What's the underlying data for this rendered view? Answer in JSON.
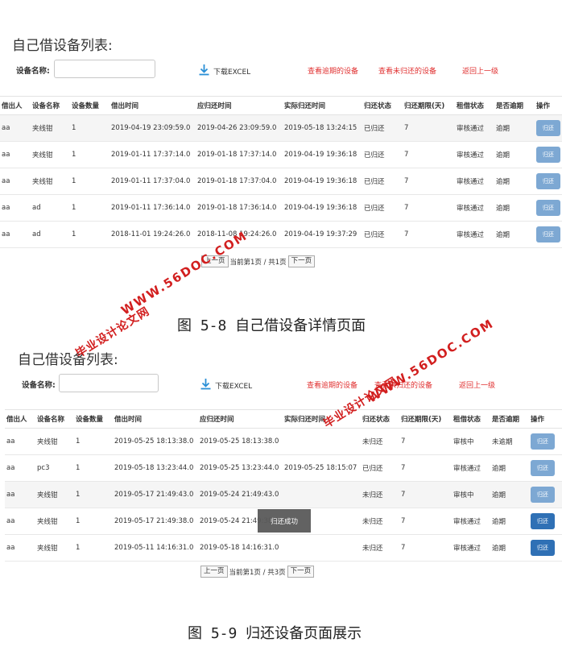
{
  "fig1": {
    "title": "自己借设备列表:",
    "search_label": "设备名称:",
    "search_value": "",
    "download_label": "下载EXCEL",
    "overdue_link": "查看逾期的设备",
    "unreturned_link": "查看未归还的设备",
    "back_link": "返回上一级",
    "columns": [
      "借出人",
      "设备名称",
      "设备数量",
      "借出时间",
      "应归还时间",
      "实际归还时间",
      "归还状态",
      "归还期限(天)",
      "租借状态",
      "是否逾期",
      "操作"
    ],
    "rows": [
      [
        "aa",
        "夹线钳",
        "1",
        "2019-04-19 23:09:59.0",
        "2019-04-26 23:09:59.0",
        "2019-05-18 13:24:15",
        "已归还",
        "7",
        "审核通过",
        "逾期",
        "归还"
      ],
      [
        "aa",
        "夹线钳",
        "1",
        "2019-01-11 17:37:14.0",
        "2019-01-18 17:37:14.0",
        "2019-04-19 19:36:18",
        "已归还",
        "7",
        "审核通过",
        "逾期",
        "归还"
      ],
      [
        "aa",
        "夹线钳",
        "1",
        "2019-01-11 17:37:04.0",
        "2019-01-18 17:37:04.0",
        "2019-04-19 19:36:18",
        "已归还",
        "7",
        "审核通过",
        "逾期",
        "归还"
      ],
      [
        "aa",
        "ad",
        "1",
        "2019-01-11 17:36:14.0",
        "2019-01-18 17:36:14.0",
        "2019-04-19 19:36:18",
        "已归还",
        "7",
        "审核通过",
        "逾期",
        "归还"
      ],
      [
        "aa",
        "ad",
        "1",
        "2018-11-01 19:24:26.0",
        "2018-11-08 19:24:26.0",
        "2019-04-19 19:37:29",
        "已归还",
        "7",
        "审核通过",
        "逾期",
        "归还"
      ]
    ],
    "pager": {
      "prev": "上一页",
      "info": "当前第1页 / 共1页",
      "next": "下一页"
    },
    "caption": "图 5-8 自己借设备详情页面"
  },
  "fig2": {
    "title": "自己借设备列表:",
    "search_label": "设备名称:",
    "search_value": "",
    "download_label": "下载EXCEL",
    "overdue_link": "查看逾期的设备",
    "unreturned_link": "查看未归还的设备",
    "back_link": "返回上一级",
    "columns": [
      "借出人",
      "设备名称",
      "设备数量",
      "借出时间",
      "应归还时间",
      "实际归还时间",
      "归还状态",
      "归还期限(天)",
      "租借状态",
      "是否逾期",
      "操作"
    ],
    "rows": [
      [
        "aa",
        "夹线钳",
        "1",
        "2019-05-25 18:13:38.0",
        "2019-05-25 18:13:38.0",
        "",
        "未归还",
        "7",
        "审核中",
        "未逾期",
        "归还"
      ],
      [
        "aa",
        "pc3",
        "1",
        "2019-05-18 13:23:44.0",
        "2019-05-25 13:23:44.0",
        "2019-05-25 18:15:07",
        "已归还",
        "7",
        "审核通过",
        "逾期",
        "归还"
      ],
      [
        "aa",
        "夹线钳",
        "1",
        "2019-05-17 21:49:43.0",
        "2019-05-24 21:49:43.0",
        "",
        "未归还",
        "7",
        "审核中",
        "逾期",
        "归还"
      ],
      [
        "aa",
        "夹线钳",
        "1",
        "2019-05-17 21:49:38.0",
        "2019-05-24 21:49:38.0",
        "",
        "未归还",
        "7",
        "审核通过",
        "逾期",
        "归还"
      ],
      [
        "aa",
        "夹线钳",
        "1",
        "2019-05-11 14:16:31.0",
        "2019-05-18 14:16:31.0",
        "",
        "未归还",
        "7",
        "审核通过",
        "逾期",
        "归还"
      ]
    ],
    "toast": "归还成功",
    "pager": {
      "prev": "上一页",
      "info": "当前第1页 / 共3页",
      "next": "下一页"
    },
    "caption": "图 5-9 归还设备页面展示"
  },
  "watermarks": {
    "url": "WWW.56DOC.COM",
    "site": "毕业设计论文网"
  },
  "colors": {
    "link_red": "#e03030",
    "btn_light": "#7da8d3",
    "btn_dark": "#2f70b5",
    "watermark": "#d21f1f",
    "download_icon": "#2a8fd6"
  }
}
